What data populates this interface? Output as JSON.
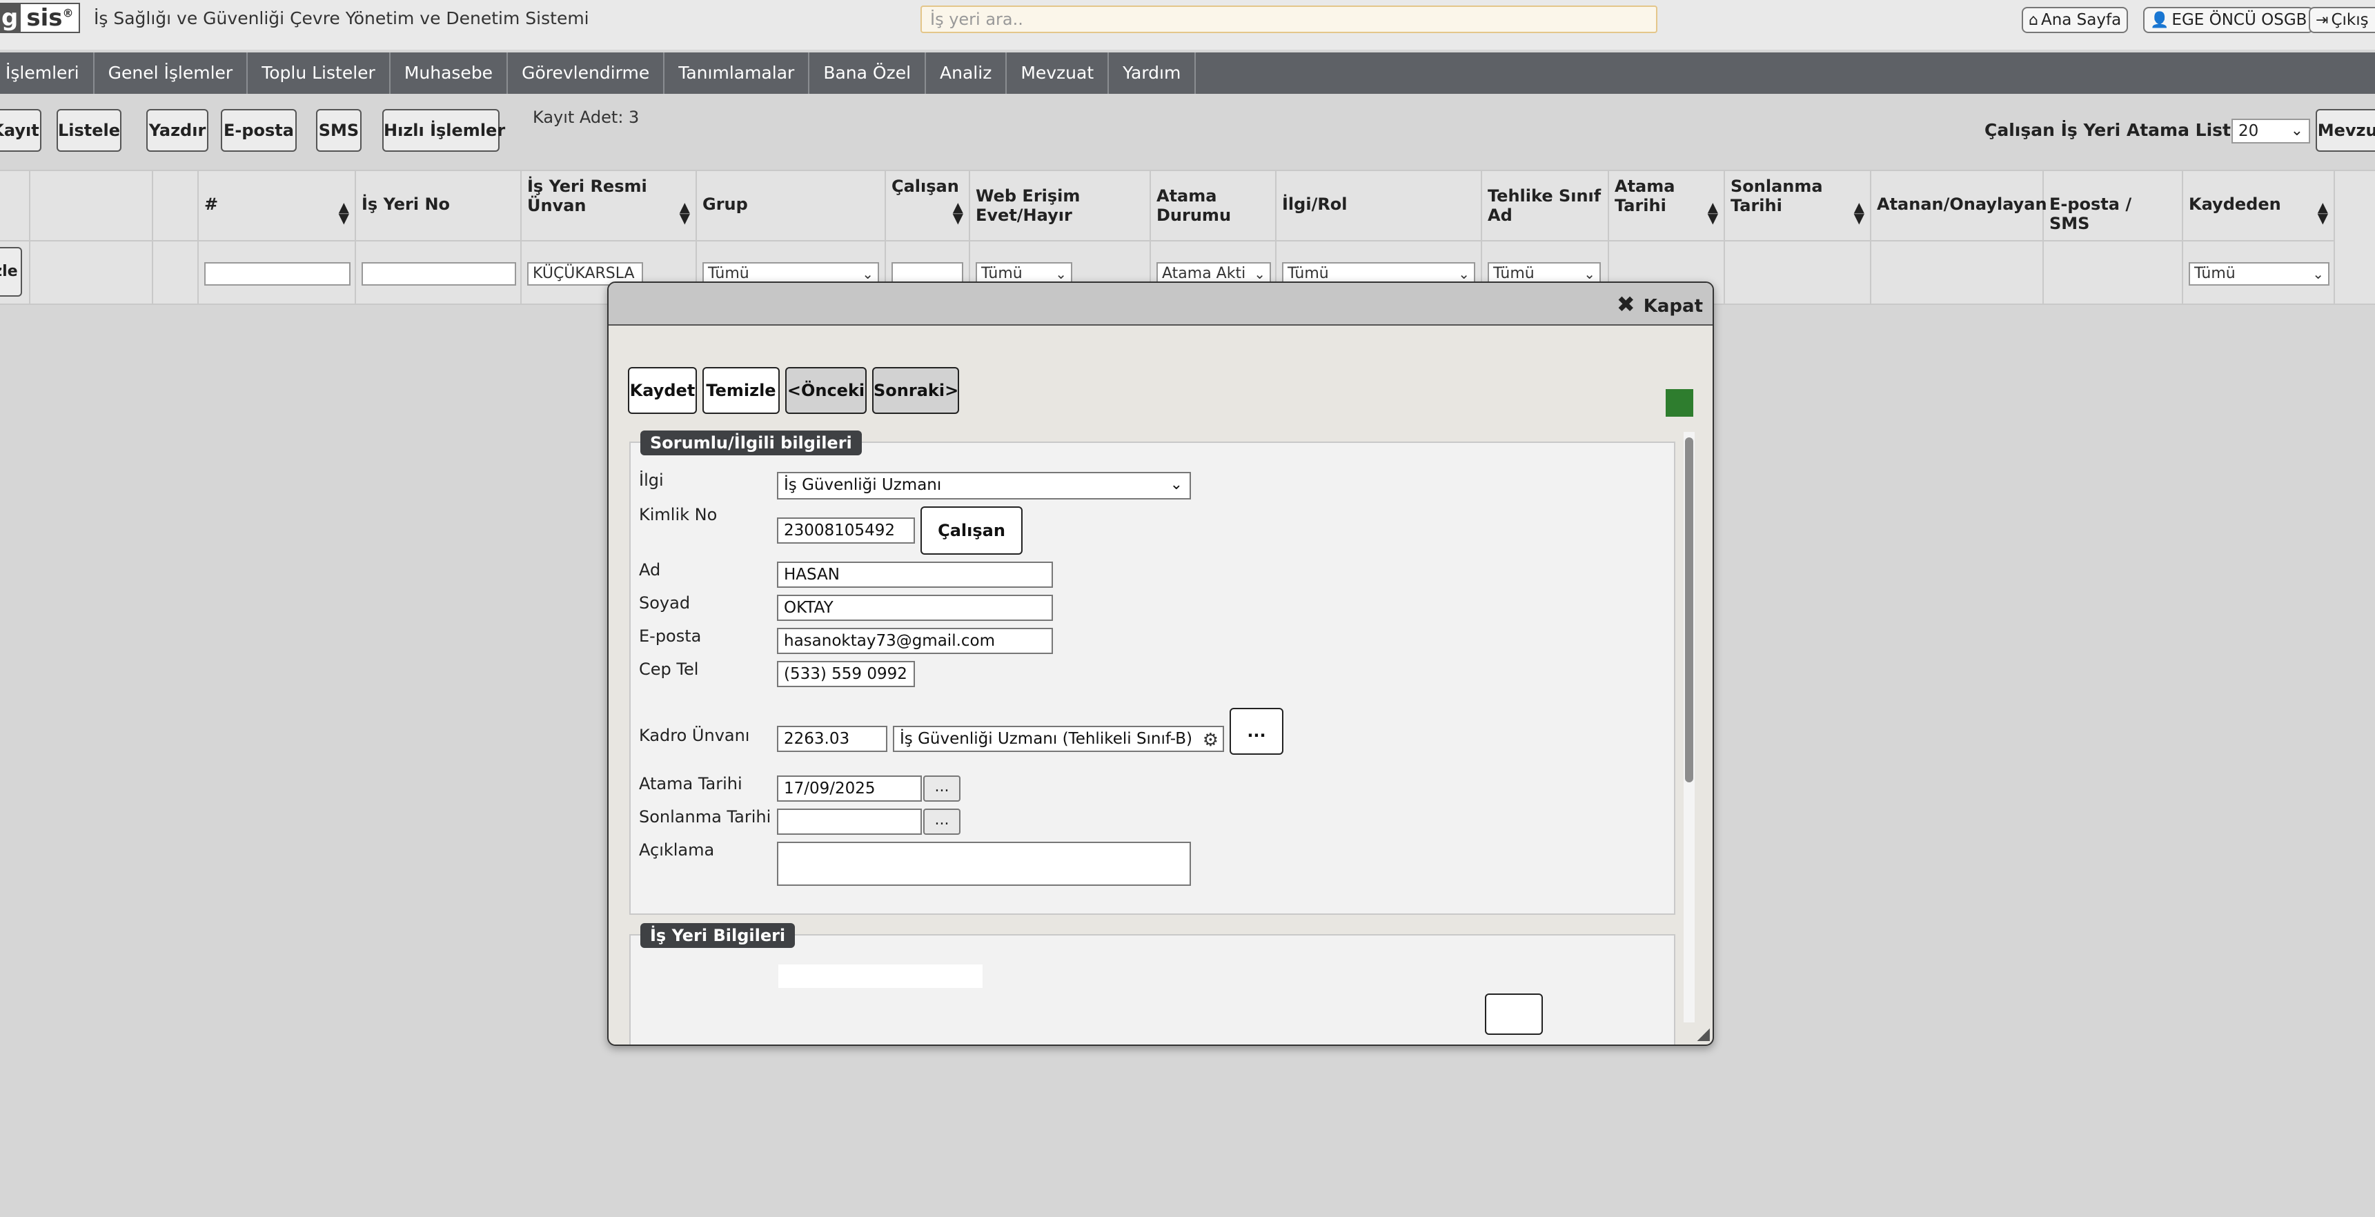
{
  "app": {
    "logo_left": "g",
    "logo_right": "sis",
    "logo_mark": "®",
    "title": "İş Sağlığı ve Güvenliği Çevre Yönetim ve Denetim Sistemi",
    "search_placeholder": "İş yeri ara.."
  },
  "topbar": {
    "home": "Ana Sayfa",
    "company": "EGE ÖNCÜ OSGB",
    "logout": "Çıkış"
  },
  "nav": [
    "İşlemleri",
    "Genel İşlemler",
    "Toplu Listeler",
    "Muhasebe",
    "Görevlendirme",
    "Tanımlamalar",
    "Bana Özel",
    "Analiz",
    "Mevzuat",
    "Yardım"
  ],
  "toolbar": {
    "new": "Kayıt",
    "list": "Listele",
    "print": "Yazdır",
    "email": "E-posta",
    "sms": "SMS",
    "quick": "Hızlı İşlemler",
    "count": "Kayıt Adet: 3",
    "list_title": "Çalışan İş Yeri Atama Liste",
    "page_size": "20",
    "law": "Mevzuat"
  },
  "grid": {
    "headers": {
      "num": "#",
      "ws_no": "İş Yeri No",
      "ws_title": "İş Yeri Resmi Ünvan",
      "group": "Grup",
      "employee": "Çalışan",
      "web": "Web Erişim Evet/Hayır",
      "assign_status": "Atama Durumu",
      "role": "İlgi/Rol",
      "hazard": "Tehlike Sınıf Ad",
      "assign_date": "Atama Tarihi",
      "end_date": "Sonlanma Tarihi",
      "approver": "Atanan/Onaylayan",
      "email_sms": "E-posta / SMS",
      "recorder": "Kaydeden"
    },
    "filters": {
      "clear": "zle",
      "ws_title": "KÜÇÜKARSLA",
      "group": "Tümü",
      "web": "Tümü",
      "assign_status": "Atama Akti",
      "role": "Tümü",
      "hazard": "Tümü",
      "recorder": "Tümü"
    }
  },
  "modal": {
    "close": "Kapat",
    "buttons": {
      "save": "Kaydet",
      "clear": "Temizle",
      "prev": "<Önceki",
      "next": "Sonraki>"
    },
    "section1": "Sorumlu/İlgili bilgileri",
    "section2": "İş Yeri Bilgileri",
    "fields": {
      "ilgi_label": "İlgi",
      "ilgi_value": "İş Güvenliği Uzmanı",
      "tc_label": "Kimlik No",
      "tc_value": "23008105492",
      "find_employee": "Çalışan Bul",
      "name_label": "Ad",
      "name_value": "HASAN",
      "surname_label": "Soyad",
      "surname_value": "OKTAY",
      "email_label": "E-posta",
      "email_value": "hasanoktay73@gmail.com",
      "phone_label": "Cep Tel",
      "phone_value": "(533) 559 0992",
      "title_label": "Kadro Ünvanı",
      "title_code": "2263.03",
      "title_value": "İş Güvenliği Uzmanı (Tehlikeli Sınıf-B)",
      "more": "...",
      "assign_date_label": "Atama Tarihi",
      "assign_date_value": "17/09/2025",
      "end_date_label": "Sonlanma Tarihi",
      "end_date_value": "",
      "desc_label": "Açıklama",
      "date_btn": "..."
    }
  },
  "colors": {
    "nav_bg": "#5e6166",
    "status_green": "#2e7d2e",
    "section_title_bg": "#3f4144"
  }
}
